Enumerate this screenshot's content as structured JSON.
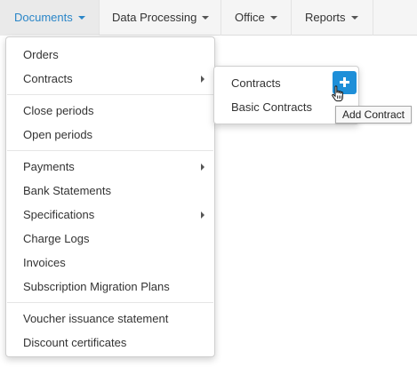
{
  "nav": {
    "documents": "Documents",
    "data_processing": "Data Processing",
    "office": "Office",
    "reports": "Reports"
  },
  "documents_menu": {
    "orders": "Orders",
    "contracts": "Contracts",
    "close_periods": "Close periods",
    "open_periods": "Open periods",
    "payments": "Payments",
    "bank_statements": "Bank Statements",
    "specifications": "Specifications",
    "charge_logs": "Charge Logs",
    "invoices": "Invoices",
    "subscription_migration_plans": "Subscription Migration Plans",
    "voucher_issuance_statement": "Voucher issuance statement",
    "discount_certificates": "Discount certificates"
  },
  "contracts_submenu": {
    "contracts": "Contracts",
    "basic_contracts": "Basic Contracts"
  },
  "tooltip": {
    "add_contract": "Add Contract"
  },
  "icons": {
    "caret": "caret-down-icon",
    "submenu_arrow": "chevron-right-icon",
    "add": "plus-icon",
    "pointer": "hand-pointer-cursor-icon"
  },
  "colors": {
    "accent": "#2a86c8",
    "add_button": "#1e8fd8",
    "navbar_bg": "#f5f5f5"
  }
}
